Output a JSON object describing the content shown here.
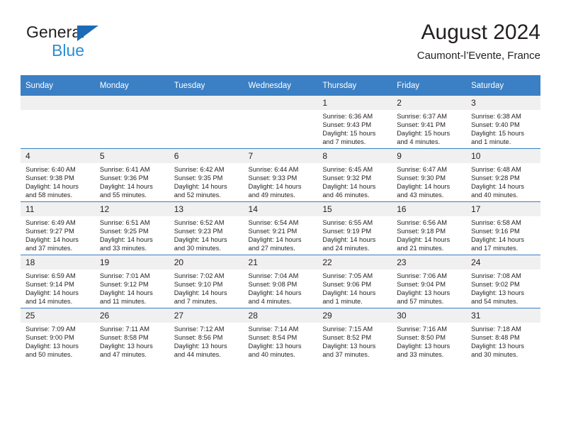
{
  "brand": {
    "line1": "General",
    "line2": "Blue",
    "triangle_icon": "brand-triangle-icon",
    "accent_color": "#1b6cb5",
    "accent_color_light": "#2a8fd4"
  },
  "header": {
    "title": "August 2024",
    "subtitle": "Caumont-l’Evente, France"
  },
  "theme": {
    "header_row_bg": "#3b7fc4",
    "daynum_bg": "#f0f0f0",
    "text_color": "#231f20"
  },
  "calendar": {
    "weekday_headers": [
      "Sunday",
      "Monday",
      "Tuesday",
      "Wednesday",
      "Thursday",
      "Friday",
      "Saturday"
    ],
    "weeks": [
      [
        {
          "day": "",
          "empty": true,
          "lines": []
        },
        {
          "day": "",
          "empty": true,
          "lines": []
        },
        {
          "day": "",
          "empty": true,
          "lines": []
        },
        {
          "day": "",
          "empty": true,
          "lines": []
        },
        {
          "day": "1",
          "empty": false,
          "lines": [
            "Sunrise: 6:36 AM",
            "Sunset: 9:43 PM",
            "Daylight: 15 hours",
            "and 7 minutes."
          ]
        },
        {
          "day": "2",
          "empty": false,
          "lines": [
            "Sunrise: 6:37 AM",
            "Sunset: 9:41 PM",
            "Daylight: 15 hours",
            "and 4 minutes."
          ]
        },
        {
          "day": "3",
          "empty": false,
          "lines": [
            "Sunrise: 6:38 AM",
            "Sunset: 9:40 PM",
            "Daylight: 15 hours",
            "and 1 minute."
          ]
        }
      ],
      [
        {
          "day": "4",
          "empty": false,
          "lines": [
            "Sunrise: 6:40 AM",
            "Sunset: 9:38 PM",
            "Daylight: 14 hours",
            "and 58 minutes."
          ]
        },
        {
          "day": "5",
          "empty": false,
          "lines": [
            "Sunrise: 6:41 AM",
            "Sunset: 9:36 PM",
            "Daylight: 14 hours",
            "and 55 minutes."
          ]
        },
        {
          "day": "6",
          "empty": false,
          "lines": [
            "Sunrise: 6:42 AM",
            "Sunset: 9:35 PM",
            "Daylight: 14 hours",
            "and 52 minutes."
          ]
        },
        {
          "day": "7",
          "empty": false,
          "lines": [
            "Sunrise: 6:44 AM",
            "Sunset: 9:33 PM",
            "Daylight: 14 hours",
            "and 49 minutes."
          ]
        },
        {
          "day": "8",
          "empty": false,
          "lines": [
            "Sunrise: 6:45 AM",
            "Sunset: 9:32 PM",
            "Daylight: 14 hours",
            "and 46 minutes."
          ]
        },
        {
          "day": "9",
          "empty": false,
          "lines": [
            "Sunrise: 6:47 AM",
            "Sunset: 9:30 PM",
            "Daylight: 14 hours",
            "and 43 minutes."
          ]
        },
        {
          "day": "10",
          "empty": false,
          "lines": [
            "Sunrise: 6:48 AM",
            "Sunset: 9:28 PM",
            "Daylight: 14 hours",
            "and 40 minutes."
          ]
        }
      ],
      [
        {
          "day": "11",
          "empty": false,
          "lines": [
            "Sunrise: 6:49 AM",
            "Sunset: 9:27 PM",
            "Daylight: 14 hours",
            "and 37 minutes."
          ]
        },
        {
          "day": "12",
          "empty": false,
          "lines": [
            "Sunrise: 6:51 AM",
            "Sunset: 9:25 PM",
            "Daylight: 14 hours",
            "and 33 minutes."
          ]
        },
        {
          "day": "13",
          "empty": false,
          "lines": [
            "Sunrise: 6:52 AM",
            "Sunset: 9:23 PM",
            "Daylight: 14 hours",
            "and 30 minutes."
          ]
        },
        {
          "day": "14",
          "empty": false,
          "lines": [
            "Sunrise: 6:54 AM",
            "Sunset: 9:21 PM",
            "Daylight: 14 hours",
            "and 27 minutes."
          ]
        },
        {
          "day": "15",
          "empty": false,
          "lines": [
            "Sunrise: 6:55 AM",
            "Sunset: 9:19 PM",
            "Daylight: 14 hours",
            "and 24 minutes."
          ]
        },
        {
          "day": "16",
          "empty": false,
          "lines": [
            "Sunrise: 6:56 AM",
            "Sunset: 9:18 PM",
            "Daylight: 14 hours",
            "and 21 minutes."
          ]
        },
        {
          "day": "17",
          "empty": false,
          "lines": [
            "Sunrise: 6:58 AM",
            "Sunset: 9:16 PM",
            "Daylight: 14 hours",
            "and 17 minutes."
          ]
        }
      ],
      [
        {
          "day": "18",
          "empty": false,
          "lines": [
            "Sunrise: 6:59 AM",
            "Sunset: 9:14 PM",
            "Daylight: 14 hours",
            "and 14 minutes."
          ]
        },
        {
          "day": "19",
          "empty": false,
          "lines": [
            "Sunrise: 7:01 AM",
            "Sunset: 9:12 PM",
            "Daylight: 14 hours",
            "and 11 minutes."
          ]
        },
        {
          "day": "20",
          "empty": false,
          "lines": [
            "Sunrise: 7:02 AM",
            "Sunset: 9:10 PM",
            "Daylight: 14 hours",
            "and 7 minutes."
          ]
        },
        {
          "day": "21",
          "empty": false,
          "lines": [
            "Sunrise: 7:04 AM",
            "Sunset: 9:08 PM",
            "Daylight: 14 hours",
            "and 4 minutes."
          ]
        },
        {
          "day": "22",
          "empty": false,
          "lines": [
            "Sunrise: 7:05 AM",
            "Sunset: 9:06 PM",
            "Daylight: 14 hours",
            "and 1 minute."
          ]
        },
        {
          "day": "23",
          "empty": false,
          "lines": [
            "Sunrise: 7:06 AM",
            "Sunset: 9:04 PM",
            "Daylight: 13 hours",
            "and 57 minutes."
          ]
        },
        {
          "day": "24",
          "empty": false,
          "lines": [
            "Sunrise: 7:08 AM",
            "Sunset: 9:02 PM",
            "Daylight: 13 hours",
            "and 54 minutes."
          ]
        }
      ],
      [
        {
          "day": "25",
          "empty": false,
          "lines": [
            "Sunrise: 7:09 AM",
            "Sunset: 9:00 PM",
            "Daylight: 13 hours",
            "and 50 minutes."
          ]
        },
        {
          "day": "26",
          "empty": false,
          "lines": [
            "Sunrise: 7:11 AM",
            "Sunset: 8:58 PM",
            "Daylight: 13 hours",
            "and 47 minutes."
          ]
        },
        {
          "day": "27",
          "empty": false,
          "lines": [
            "Sunrise: 7:12 AM",
            "Sunset: 8:56 PM",
            "Daylight: 13 hours",
            "and 44 minutes."
          ]
        },
        {
          "day": "28",
          "empty": false,
          "lines": [
            "Sunrise: 7:14 AM",
            "Sunset: 8:54 PM",
            "Daylight: 13 hours",
            "and 40 minutes."
          ]
        },
        {
          "day": "29",
          "empty": false,
          "lines": [
            "Sunrise: 7:15 AM",
            "Sunset: 8:52 PM",
            "Daylight: 13 hours",
            "and 37 minutes."
          ]
        },
        {
          "day": "30",
          "empty": false,
          "lines": [
            "Sunrise: 7:16 AM",
            "Sunset: 8:50 PM",
            "Daylight: 13 hours",
            "and 33 minutes."
          ]
        },
        {
          "day": "31",
          "empty": false,
          "lines": [
            "Sunrise: 7:18 AM",
            "Sunset: 8:48 PM",
            "Daylight: 13 hours",
            "and 30 minutes."
          ]
        }
      ]
    ]
  }
}
